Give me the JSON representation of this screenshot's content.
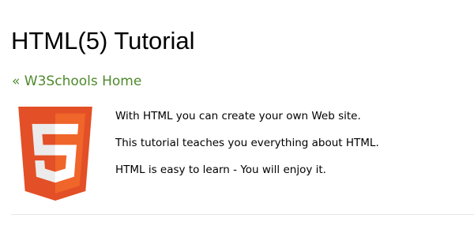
{
  "page": {
    "title": "HTML(5) Tutorial",
    "home_link": "« W3Schools Home"
  },
  "logo": {
    "icon": "html5-logo-icon",
    "glyph": "5",
    "colors": {
      "shield_dark": "#e34f26",
      "shield_light": "#ef652a",
      "glyph": "#ebebeb",
      "glyph_highlight": "#ffffff"
    }
  },
  "intro": {
    "lines": [
      "With HTML you can create your own Web site.",
      "This tutorial teaches you everything about HTML.",
      "HTML is easy to learn - You will enjoy it."
    ]
  },
  "colors": {
    "link": "#4e8a2c",
    "text": "#000000",
    "divider": "#e6e6e6",
    "background": "#ffffff"
  }
}
